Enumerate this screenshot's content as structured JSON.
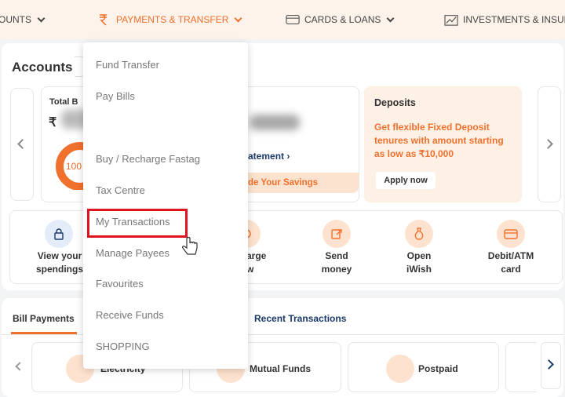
{
  "nav": {
    "items": [
      {
        "label": "OUNTS",
        "icon": "none"
      },
      {
        "label": "PAYMENTS & TRANSFER",
        "icon": "rupee-hand-icon",
        "active": true
      },
      {
        "label": "CARDS & LOANS",
        "icon": "card-icon"
      },
      {
        "label": "INVESTMENTS & INSUR",
        "icon": "chart-icon"
      }
    ]
  },
  "accounts": {
    "title": "Accounts",
    "total_label": "Total B",
    "currency": "₹",
    "donut_label": "100",
    "statement_link": "atement",
    "savings_cta": "de Your Savings"
  },
  "deposits": {
    "title": "Deposits",
    "text": "Get flexible Fixed Deposit tenures with amount starting as low as ₹10,000",
    "apply_label": "Apply now"
  },
  "quick_actions": [
    {
      "label_line1": "View your",
      "label_line2": "spendings",
      "icon": "lock-icon"
    },
    {
      "label_line1": "arge",
      "label_line2": "w",
      "icon": "recharge-icon"
    },
    {
      "label_line1": "Send",
      "label_line2": "money",
      "icon": "send-money-icon"
    },
    {
      "label_line1": "Open",
      "label_line2": "iWish",
      "icon": "piggy-bag-icon"
    },
    {
      "label_line1": "Debit/ATM",
      "label_line2": "card",
      "icon": "debit-card-icon"
    }
  ],
  "bottom": {
    "tabs": [
      "Bill Payments",
      "Recent Transactions"
    ],
    "bills": [
      {
        "label": "Electricity",
        "icon": "electricity-icon"
      },
      {
        "label": "Mutual Funds",
        "icon": "mutual-funds-icon"
      },
      {
        "label": "Postpaid",
        "icon": "postpaid-icon"
      }
    ]
  },
  "dropdown": {
    "items": [
      "Fund Transfer",
      "Pay Bills",
      "Buy / Recharge Fastag",
      "Tax Centre",
      "My Transactions",
      "Manage Payees",
      "Favourites",
      "Receive Funds",
      "SHOPPING"
    ],
    "highlighted": "My Transactions"
  },
  "colors": {
    "accent": "#f0702d",
    "navy": "#1a3a6b",
    "highlight_box": "#e0141e",
    "peach": "#fdf1e6"
  }
}
